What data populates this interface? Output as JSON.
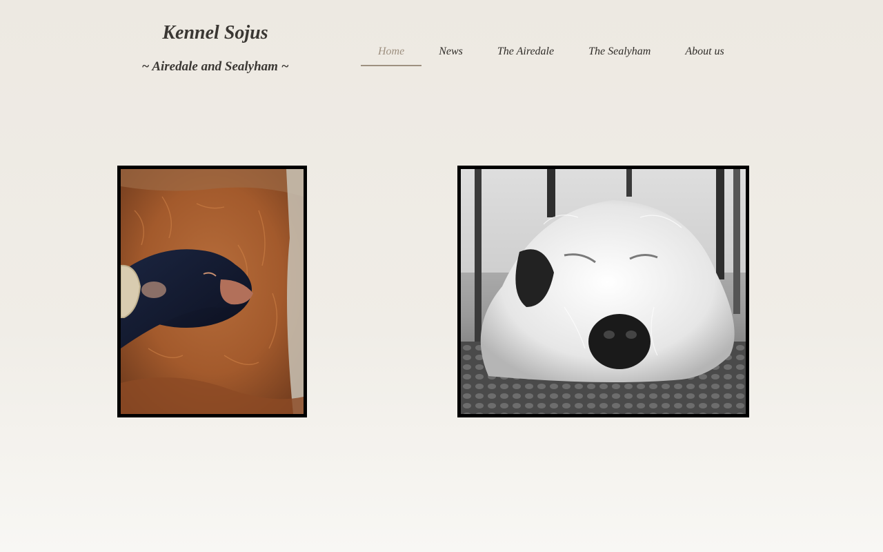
{
  "header": {
    "title": "Kennel Sojus",
    "subtitle": "~ Airedale and Sealyham ~"
  },
  "nav": {
    "items": [
      {
        "label": "Home",
        "active": true
      },
      {
        "label": "News",
        "active": false
      },
      {
        "label": "The Airedale",
        "active": false
      },
      {
        "label": "The Sealyham",
        "active": false
      },
      {
        "label": "About us",
        "active": false
      }
    ]
  },
  "main": {
    "photos": [
      {
        "subject": "black puppy sleeping on red-brown airedale",
        "icon": "puppy-photo"
      },
      {
        "subject": "black and white sealyham puppy lying on mat",
        "icon": "sealyham-photo"
      }
    ]
  },
  "colors": {
    "background": "#ede9e2",
    "text": "#3a3733",
    "nav_active": "#9e9080",
    "frame": "#000000"
  }
}
